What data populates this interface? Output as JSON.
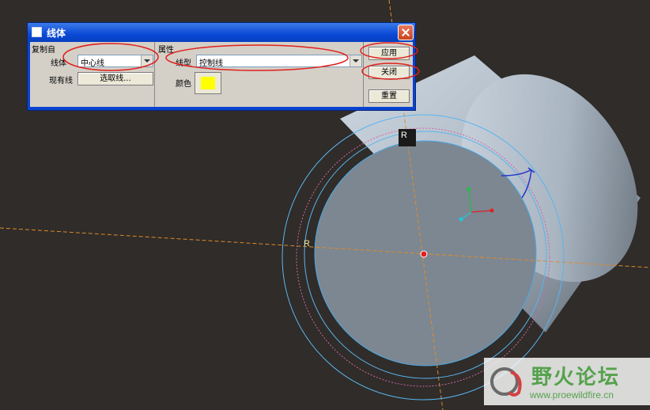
{
  "dialog": {
    "title": "线体",
    "copy_from": {
      "section_title": "复制自",
      "line_label": "线体",
      "line_value": "中心线",
      "existing_label": "现有线",
      "select_button": "选取线..."
    },
    "attributes": {
      "section_title": "属性",
      "type_label": "线型",
      "type_value": "控制线",
      "color_label": "颜色",
      "color_value": "#ffff00"
    },
    "buttons": {
      "apply": "应用",
      "close": "关闭",
      "reset": "重置"
    }
  },
  "viewport": {
    "labels": [
      "R",
      "R"
    ]
  },
  "watermark": {
    "title": "野火论坛",
    "url": "www.proewildfire.cn"
  },
  "colors": {
    "background": "#2f2c29",
    "cylinder": "#a8b4c0",
    "cylinder_face": "#7c8792",
    "centerline": "#e08a2a",
    "circle": "#5ab4ef",
    "control_circle": "#d466a8",
    "annotation": "#e0201c"
  }
}
